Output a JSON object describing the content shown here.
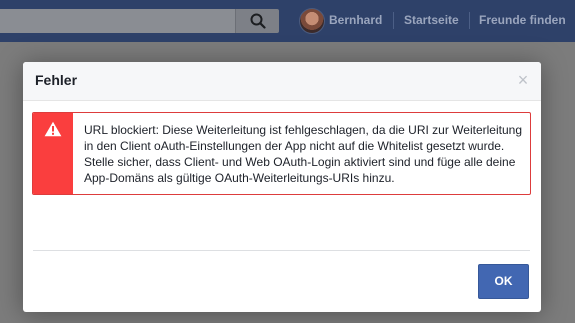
{
  "topbar": {
    "search_placeholder": "",
    "user_name": "Bernhard",
    "nav_home": "Startseite",
    "nav_find_friends": "Freunde finden"
  },
  "dialog": {
    "title": "Fehler",
    "close_glyph": "×",
    "error_message": "URL blockiert: Diese Weiterleitung ist fehlgeschlagen, da die URI zur Weiterleitung in den Client oAuth-Einstellungen der App nicht auf die Whitelist gesetzt wurde. Stelle sicher, dass Client- und Web OAuth-Login aktiviert sind und füge alle deine App-Domäns als gültige OAuth-Weiterleitungs-URIs hinzu.",
    "ok_label": "OK"
  },
  "colors": {
    "topbar": "#2e4169",
    "overlay": "#7c7c7c",
    "error_red": "#fa3e3e",
    "primary_button": "#4267b2"
  },
  "icons": {
    "search": "search-icon",
    "warning": "warning-icon",
    "close": "close-icon"
  }
}
